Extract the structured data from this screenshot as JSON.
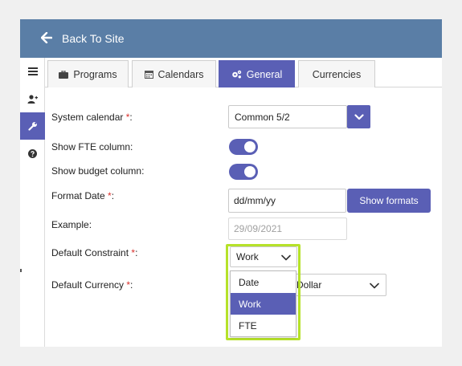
{
  "header": {
    "back_label": "Back To Site"
  },
  "sidebar": {
    "items": [
      {
        "icon": "list-icon",
        "active": false
      },
      {
        "icon": "user-add-icon",
        "active": false
      },
      {
        "icon": "wrench-icon",
        "active": true
      },
      {
        "icon": "help-icon",
        "active": false
      }
    ]
  },
  "tabs": [
    {
      "label": "Programs",
      "icon": "briefcase-icon",
      "active": false
    },
    {
      "label": "Calendars",
      "icon": "calendar-icon",
      "active": false
    },
    {
      "label": "General",
      "icon": "gears-icon",
      "active": true
    },
    {
      "label": "Currencies",
      "icon": "",
      "active": false
    }
  ],
  "form": {
    "system_calendar": {
      "label": "System calendar ",
      "required": "*",
      "colon": ":",
      "value": "Common 5/2"
    },
    "show_fte": {
      "label": "Show FTE column:",
      "on": true
    },
    "show_budget": {
      "label": "Show budget column:",
      "on": true
    },
    "format_date": {
      "label": "Format Date ",
      "required": "*",
      "colon": ":",
      "value": "dd/mm/yy",
      "button": "Show formats"
    },
    "example": {
      "label": "Example:",
      "value": "29/09/2021"
    },
    "default_constraint": {
      "label": "Default Constraint ",
      "required": "*",
      "colon": ":",
      "value": "Work",
      "options": [
        "Date",
        "Work",
        "FTE"
      ],
      "selected_index": 1
    },
    "default_currency": {
      "label": "Default Currency ",
      "required": "*",
      "colon": ":",
      "value": "Dollar"
    }
  },
  "colors": {
    "header": "#5a7ea6",
    "accent": "#5a5fb5",
    "highlight": "#b6e22a",
    "required": "#d9302c"
  }
}
